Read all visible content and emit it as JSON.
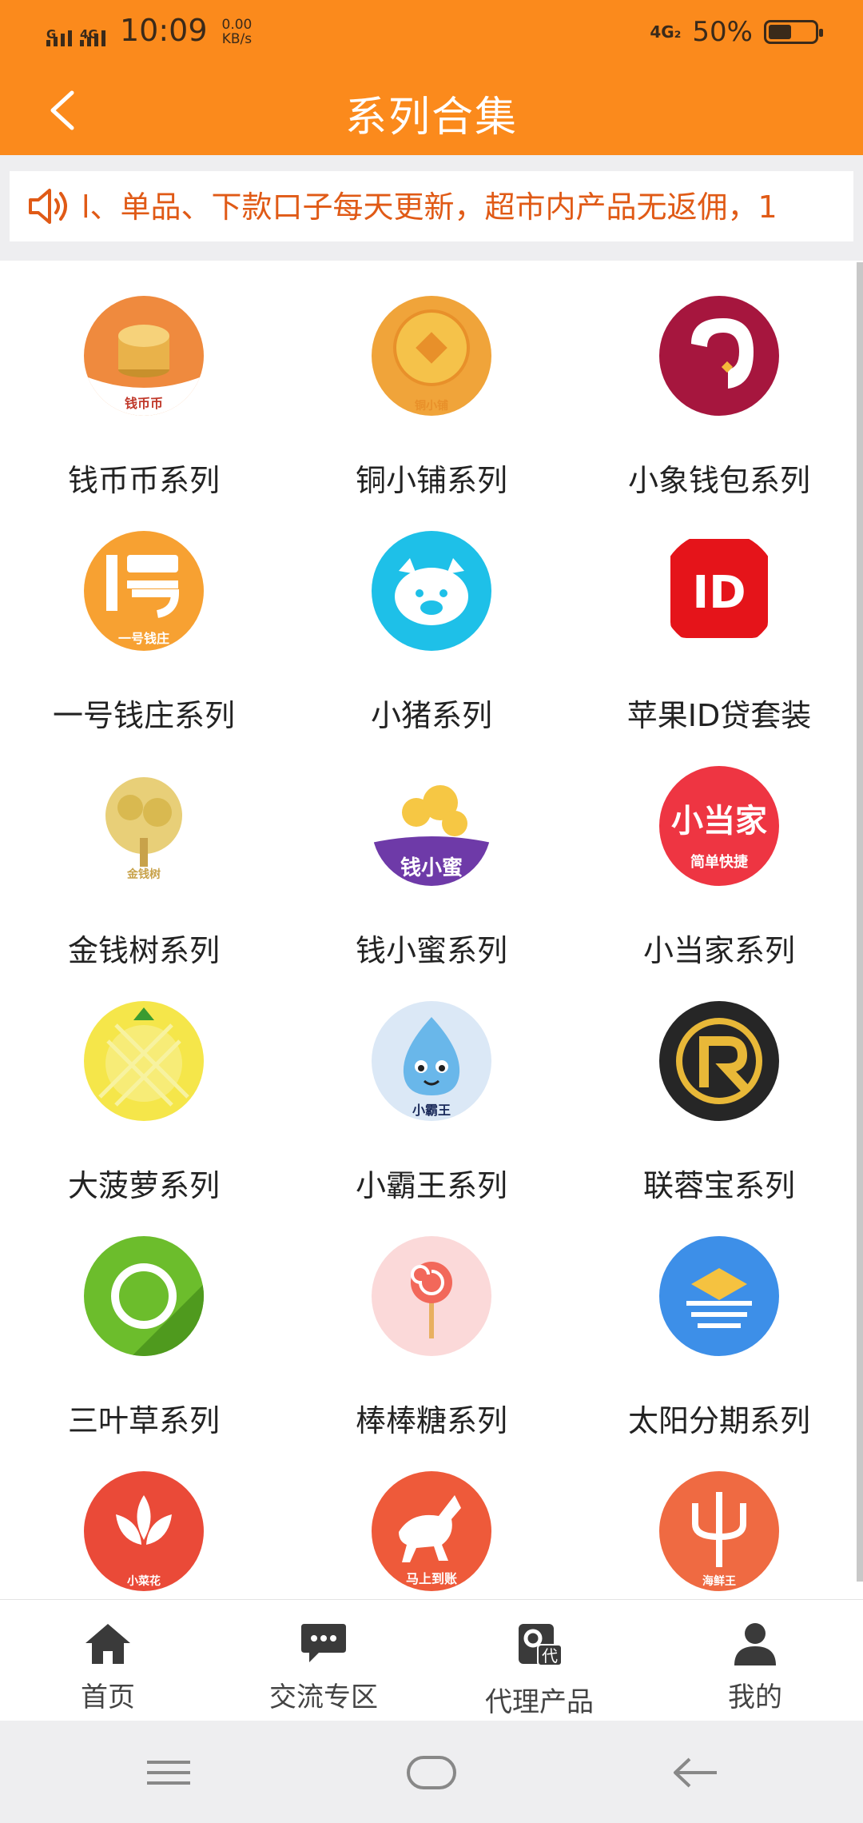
{
  "status_bar": {
    "signal1_label": "G",
    "signal2_label": "4G",
    "time": "10:09",
    "speed_value": "0.00",
    "speed_unit": "KB/s",
    "network": "4G₂",
    "battery_percent": "50%",
    "battery_level": 0.5
  },
  "header": {
    "title": "系列合集",
    "back_icon": "chevron-left-icon",
    "bg_color": "#fb8a1c"
  },
  "notice": {
    "icon": "speaker-icon",
    "text": "l、单品、下款口子每天更新，超市内产品无返佣，1"
  },
  "series": [
    {
      "name": "钱币币系列",
      "icon": "coin-stack-icon",
      "logo_text": "钱币币"
    },
    {
      "name": "铜小铺系列",
      "icon": "copper-coin-icon",
      "logo_text": "铜小铺"
    },
    {
      "name": "小象钱包系列",
      "icon": "elephant-icon",
      "logo_text": ""
    },
    {
      "name": "一号钱庄系列",
      "icon": "yihao-logo-icon",
      "logo_text": "一号钱庄"
    },
    {
      "name": "小猪系列",
      "icon": "pig-icon",
      "logo_text": ""
    },
    {
      "name": "苹果ID贷套装",
      "icon": "id-badge-icon",
      "logo_text": "ID"
    },
    {
      "name": "金钱树系列",
      "icon": "money-tree-icon",
      "logo_text": "金钱树"
    },
    {
      "name": "钱小蜜系列",
      "icon": "coins-bag-icon",
      "logo_text": "钱小蜜"
    },
    {
      "name": "小当家系列",
      "icon": "xiaodangjia-logo-icon",
      "logo_text": "小当家",
      "logo_subtext": "简单快捷"
    },
    {
      "name": "大菠萝系列",
      "icon": "pineapple-icon",
      "logo_text": ""
    },
    {
      "name": "小霸王系列",
      "icon": "mascot-icon",
      "logo_text": "小霸王"
    },
    {
      "name": "联蓉宝系列",
      "icon": "r-logo-icon",
      "logo_text": ""
    },
    {
      "name": "三叶草系列",
      "icon": "green-ring-icon",
      "logo_text": ""
    },
    {
      "name": "棒棒糖系列",
      "icon": "lollipop-icon",
      "logo_text": ""
    },
    {
      "name": "太阳分期系列",
      "icon": "sun-waves-icon",
      "logo_text": ""
    },
    {
      "name": "",
      "icon": "lotus-icon",
      "logo_text": "小菜花"
    },
    {
      "name": "",
      "icon": "horse-icon",
      "logo_text": "马上到账"
    },
    {
      "name": "",
      "icon": "trident-icon",
      "logo_text": "海鲜王"
    }
  ],
  "tabs": [
    {
      "label": "首页",
      "icon": "home-icon"
    },
    {
      "label": "交流专区",
      "icon": "chat-icon"
    },
    {
      "label": "代理产品",
      "icon": "agent-gear-icon",
      "icon_text": "代"
    },
    {
      "label": "我的",
      "icon": "user-icon"
    }
  ],
  "system_nav": [
    "menu-icon",
    "home-pill-icon",
    "back-arrow-icon"
  ]
}
